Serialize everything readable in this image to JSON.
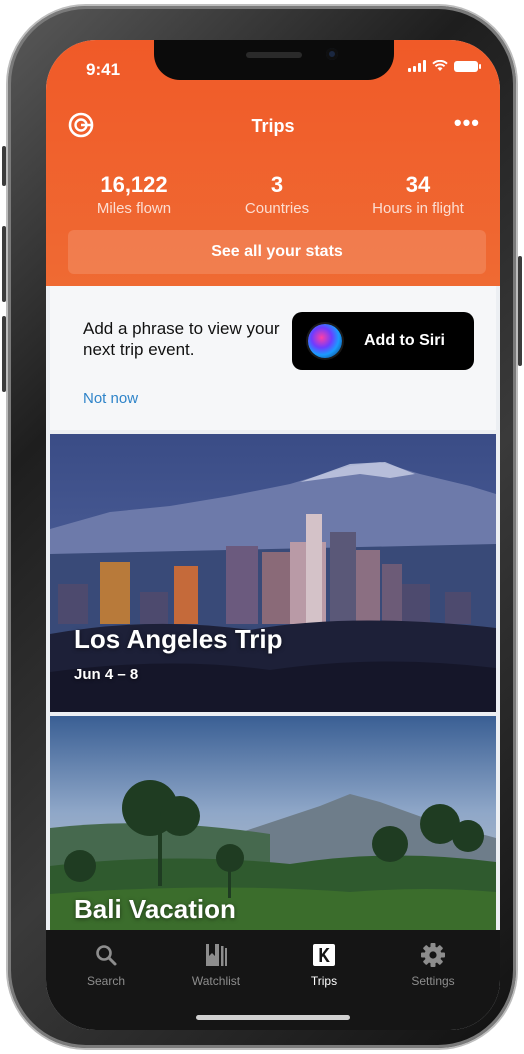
{
  "status_bar": {
    "time": "9:41"
  },
  "nav": {
    "title": "Trips",
    "left_icon": "logo-icon",
    "right_icon": "more-icon"
  },
  "stats": [
    {
      "value": "16,122",
      "label": "Miles flown"
    },
    {
      "value": "3",
      "label": "Countries"
    },
    {
      "value": "34",
      "label": "Hours in flight"
    }
  ],
  "stats_button": "See all your stats",
  "siri_card": {
    "message": "Add a phrase to view your next trip event.",
    "not_now": "Not now",
    "button_label": "Add to Siri"
  },
  "trips": [
    {
      "title": "Los Angeles Trip",
      "dates": "Jun 4 – 8"
    },
    {
      "title": "Bali Vacation",
      "dates": ""
    }
  ],
  "tabs": [
    {
      "label": "Search",
      "icon": "search-icon",
      "active": false
    },
    {
      "label": "Watchlist",
      "icon": "bookmark-icon",
      "active": false
    },
    {
      "label": "Trips",
      "icon": "trips-k-icon",
      "active": true
    },
    {
      "label": "Settings",
      "icon": "gear-icon",
      "active": false
    }
  ],
  "colors": {
    "accent": "#f05a28",
    "link": "#2f84c9",
    "tabbar": "#151515"
  }
}
